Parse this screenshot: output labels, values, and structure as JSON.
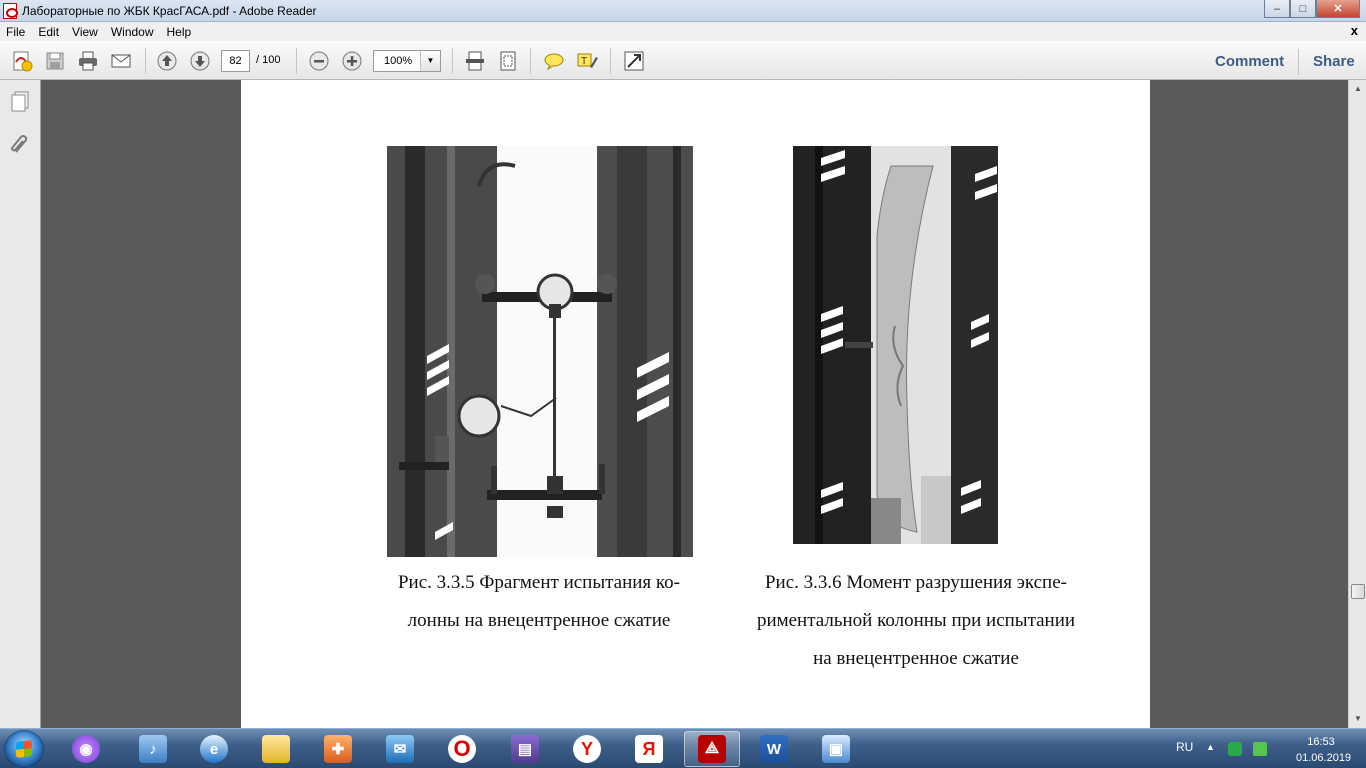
{
  "window": {
    "title": "Лабораторные по ЖБК КрасГАСА.pdf - Adobe Reader",
    "minimize": "–",
    "maximize": "□",
    "close": "✕"
  },
  "menu": {
    "items": [
      "File",
      "Edit",
      "View",
      "Window",
      "Help"
    ],
    "doc_close": "x"
  },
  "toolbar": {
    "current_page": "82",
    "total_pages": "/ 100",
    "zoom": "100%",
    "zoom_dropdown": "▼",
    "comment_label": "Comment",
    "share_label": "Share",
    "icons": [
      "create-pdf-icon",
      "save-icon",
      "print-icon",
      "email-icon",
      "previous-page-icon",
      "next-page-icon",
      "zoom-out-icon",
      "zoom-in-icon",
      "fit-width-icon",
      "fit-page-icon",
      "sticky-note-icon",
      "highlight-text-icon",
      "full-screen-icon"
    ]
  },
  "nav_pane": {
    "icons": [
      "page-thumbnails-icon",
      "attachments-icon"
    ]
  },
  "document": {
    "figure_left": {
      "caption_line1": "Рис. 3.3.5   Фрагмент испытания ко-",
      "caption_line2": "лонны на внецентренное сжатие"
    },
    "figure_right": {
      "caption_line1": "Рис. 3.3.6   Момент разрушения экспе-",
      "caption_line2": "риментальной колонны при испытании",
      "caption_line3": "на внецентренное сжатие"
    }
  },
  "scrollbar": {
    "up": "▲",
    "down": "▼",
    "position_fraction": 0.8
  },
  "taskbar": {
    "apps": [
      "alice-icon",
      "volume-icon",
      "ie-icon",
      "explorer-icon",
      "media-icon",
      "mail-icon",
      "opera-icon",
      "winrar-icon",
      "yandex-browser-icon",
      "yandex-icon",
      "adobe-reader-icon",
      "word-icon",
      "remote-icon"
    ],
    "active_app": "adobe-reader-icon",
    "lang": "RU",
    "time": "16:53",
    "date": "01.06.2019"
  }
}
